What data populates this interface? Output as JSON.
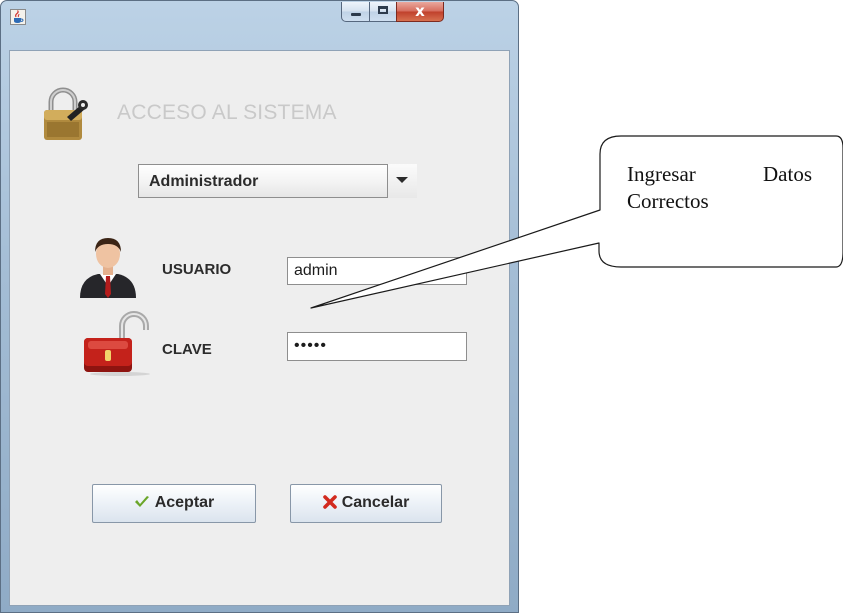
{
  "window": {
    "title_icon": "java-cup-icon",
    "controls": [
      "minimize-icon",
      "maximize-icon",
      "close-icon"
    ],
    "close_glyph": "x"
  },
  "header": {
    "icon": "padlock-key-icon",
    "title": "ACCESO AL SISTEMA"
  },
  "role_select": {
    "selected": "Administrador",
    "arrow_icon": "chevron-down-icon"
  },
  "form": {
    "user_label": "USUARIO",
    "user_value": "admin",
    "user_icon": "user-avatar-icon",
    "password_label": "CLAVE",
    "password_value": "•••••",
    "password_icon": "red-padlock-icon"
  },
  "buttons": {
    "accept_label": "Aceptar",
    "accept_icon": "checkmark-icon",
    "cancel_label": "Cancelar",
    "cancel_icon": "cross-icon"
  },
  "callout": {
    "line1_word1": "Ingresar",
    "line1_word2": "Datos",
    "line2": "Correctos"
  },
  "colors": {
    "title_text": "#c9c9c9",
    "accept_check": "#6aa629",
    "cancel_cross": "#d22a1e",
    "lock_red": "#c4221b"
  }
}
